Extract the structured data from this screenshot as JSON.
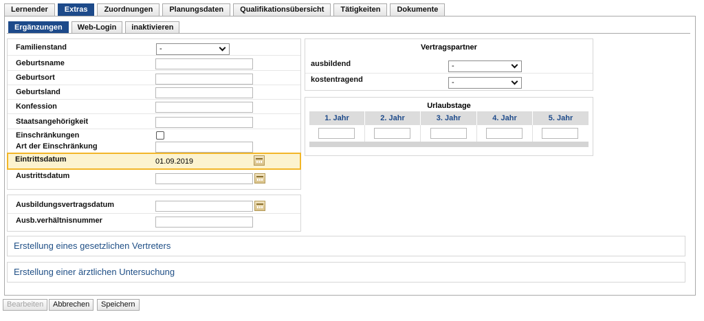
{
  "main_tabs": [
    "Lernender",
    "Extras",
    "Zuordnungen",
    "Planungsdaten",
    "Qualifikationsübersicht",
    "Tätigkeiten",
    "Dokumente"
  ],
  "main_tab_active": "Extras",
  "sub_tabs": [
    "Ergänzungen",
    "Web-Login",
    "inaktivieren"
  ],
  "sub_tab_active": "Ergänzungen",
  "personal": {
    "familienstand_label": "Familienstand",
    "familienstand_value": "-",
    "geburtsname_label": "Geburtsname",
    "geburtsort_label": "Geburtsort",
    "geburtsland_label": "Geburtsland",
    "konfession_label": "Konfession",
    "staatsangehoerigkeit_label": "Staatsangehörigkeit",
    "einschraenkungen_label": "Einschränkungen",
    "einschraenkungen_checked": false,
    "art_einschraenkung_label": "Art der Einschränkung",
    "eintrittsdatum_label": "Eintrittsdatum",
    "eintrittsdatum_value": "01.09.2019",
    "austrittsdatum_label": "Austrittsdatum"
  },
  "contract": {
    "ausbildungsvertragsdatum_label": "Ausbildungsvertragsdatum",
    "ausb_verhaeltnisnummer_label": "Ausb.verhältnisnummer"
  },
  "vertragspartner": {
    "title": "Vertragspartner",
    "ausbildend_label": "ausbildend",
    "ausbildend_value": "-",
    "kostentragend_label": "kostentragend",
    "kostentragend_value": "-"
  },
  "urlaubstage": {
    "title": "Urlaubstage",
    "columns": [
      "1. Jahr",
      "2. Jahr",
      "3. Jahr",
      "4. Jahr",
      "5. Jahr"
    ]
  },
  "sections": {
    "vertreter": "Erstellung eines gesetzlichen Vertreters",
    "untersuchung": "Erstellung einer ärztlichen Untersuchung"
  },
  "buttons": {
    "bearbeiten": "Bearbeiten",
    "abbrechen": "Abbrechen",
    "speichern": "Speichern"
  }
}
